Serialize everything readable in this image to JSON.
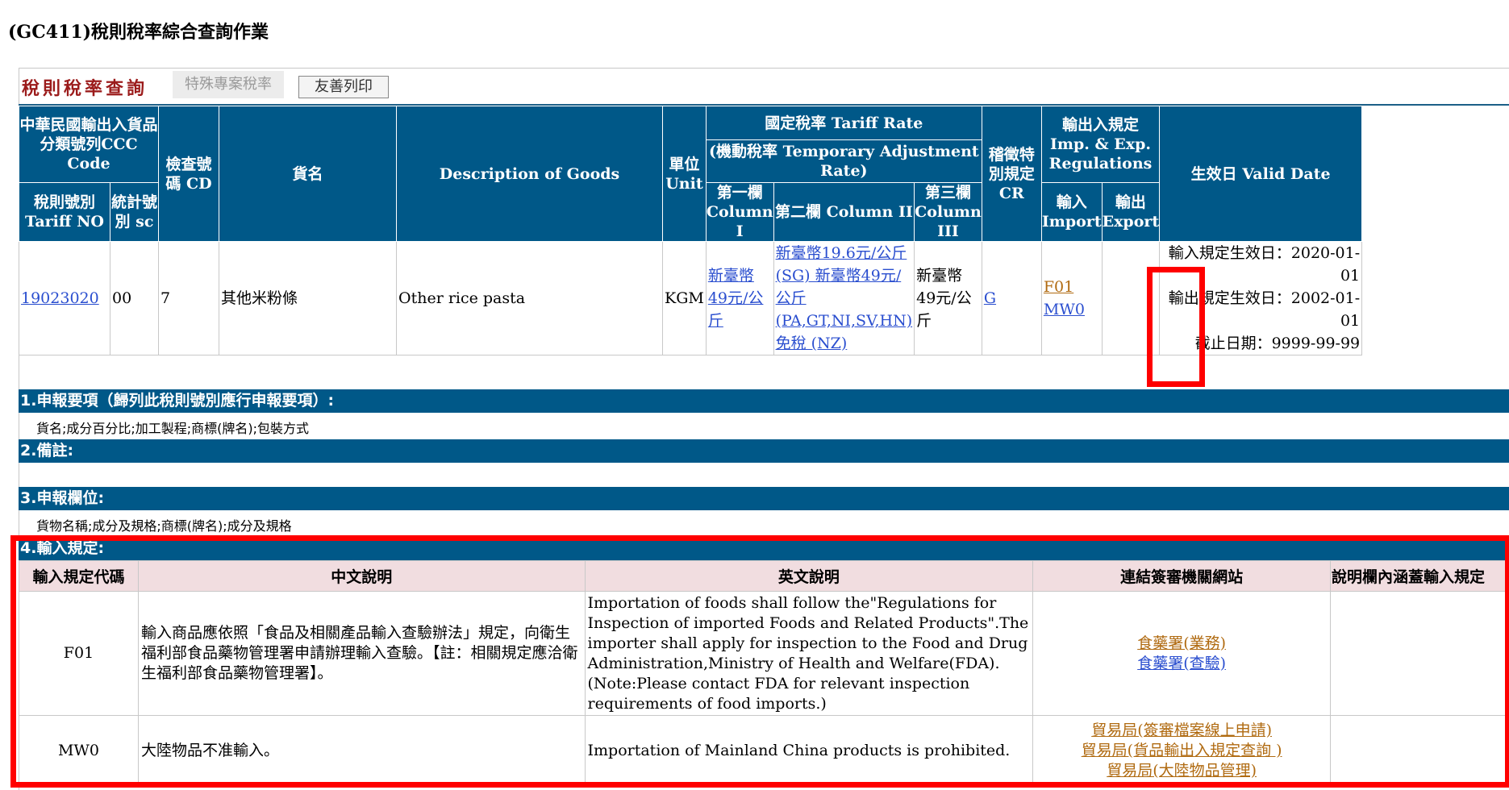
{
  "page": {
    "title": "(GC411)稅則稅率綜合查詢作業"
  },
  "tabs": {
    "active": "稅則稅率查詢",
    "inactive": "特殊專案稅率",
    "print_button": "友善列印"
  },
  "headers": {
    "ccc_code": "中華民國輸出入貨品分類號列CCC Code",
    "tariff_no": "稅則號別 Tariff NO",
    "sc": "統計號別 sc",
    "cd": "檢查號碼 CD",
    "goods_zh": "貨名",
    "goods_en": "Description of Goods",
    "unit": "單位 Unit",
    "tariff_rate": "國定稅率 Tariff Rate",
    "temp_rate": "(機動稅率 Temporary Adjustment Rate)",
    "col1": "第一欄 Column I",
    "col2": "第二欄 Column II",
    "col3": "第三欄 Column III",
    "cr": "稽徵特別規定 CR",
    "regulations": "輸出入規定 Imp. & Exp. Regulations",
    "import": "輸入 Import",
    "export": "輸出 Export",
    "valid_date": "生效日 Valid Date"
  },
  "row": {
    "tariff_no": "19023020",
    "sc": "00",
    "cd": "7",
    "goods_zh": "其他米粉條",
    "goods_en": "Other rice pasta",
    "unit": "KGM",
    "col1": "新臺幣49元/公斤",
    "col2": "新臺幣19.6元/公斤 (SG) 新臺幣49元/公斤 (PA,GT,NI,SV,HN) 免稅 (NZ)",
    "col3": "新臺幣49元/公斤",
    "cr": "G",
    "import_code1": "F01",
    "import_code2": "MW0",
    "valid_import": "輸入規定生效日：2020-01-01",
    "valid_export": "輸出規定生效日：2002-01-01",
    "valid_end": "截止日期：9999-99-99"
  },
  "sections": {
    "s1_title": "1.申報要項（歸列此稅則號別應行申報要項）:",
    "s1_text": "貨名;成分百分比;加工製程;商標(牌名);包裝方式",
    "s2_title": "2.備註:",
    "s3_title": "3.申報欄位:",
    "s3_text": "貨物名稱;成分及規格;商標(牌名);成分及規格",
    "s4_title": "4.輸入規定:"
  },
  "import_table": {
    "headers": [
      "輸入規定代碼",
      "中文說明",
      "英文說明",
      "連結簽審機關網站",
      "說明欄內涵蓋輸入規定"
    ],
    "rows": [
      {
        "code": "F01",
        "zh": "輸入商品應依照「食品及相關產品輸入查驗辦法」規定，向衛生福利部食品藥物管理署申請辦理輸入查驗。【註：相關規定應洽衛生福利部食品藥物管理署】。",
        "en": "Importation of foods shall follow the\"Regulations for Inspection of imported Foods and Related Products\".The importer shall apply for inspection to the Food and Drug Administration,Ministry of Health and Welfare(FDA). (Note:Please contact FDA for relevant inspection requirements of food imports.)",
        "links": [
          "食藥署(業務)",
          "食藥署(查驗)"
        ]
      },
      {
        "code": "MW0",
        "zh": "大陸物品不准輸入。",
        "en": "Importation of Mainland China products is prohibited.",
        "links": [
          "貿易局(簽審檔案線上申請)",
          "貿易局(貨品輸出入規定查詢 )",
          "貿易局(大陸物品管理)"
        ]
      }
    ]
  },
  "colors": {
    "header_blue": "#005888",
    "highlight_red": "#ff0000",
    "pink_header": "#f1dde0"
  }
}
